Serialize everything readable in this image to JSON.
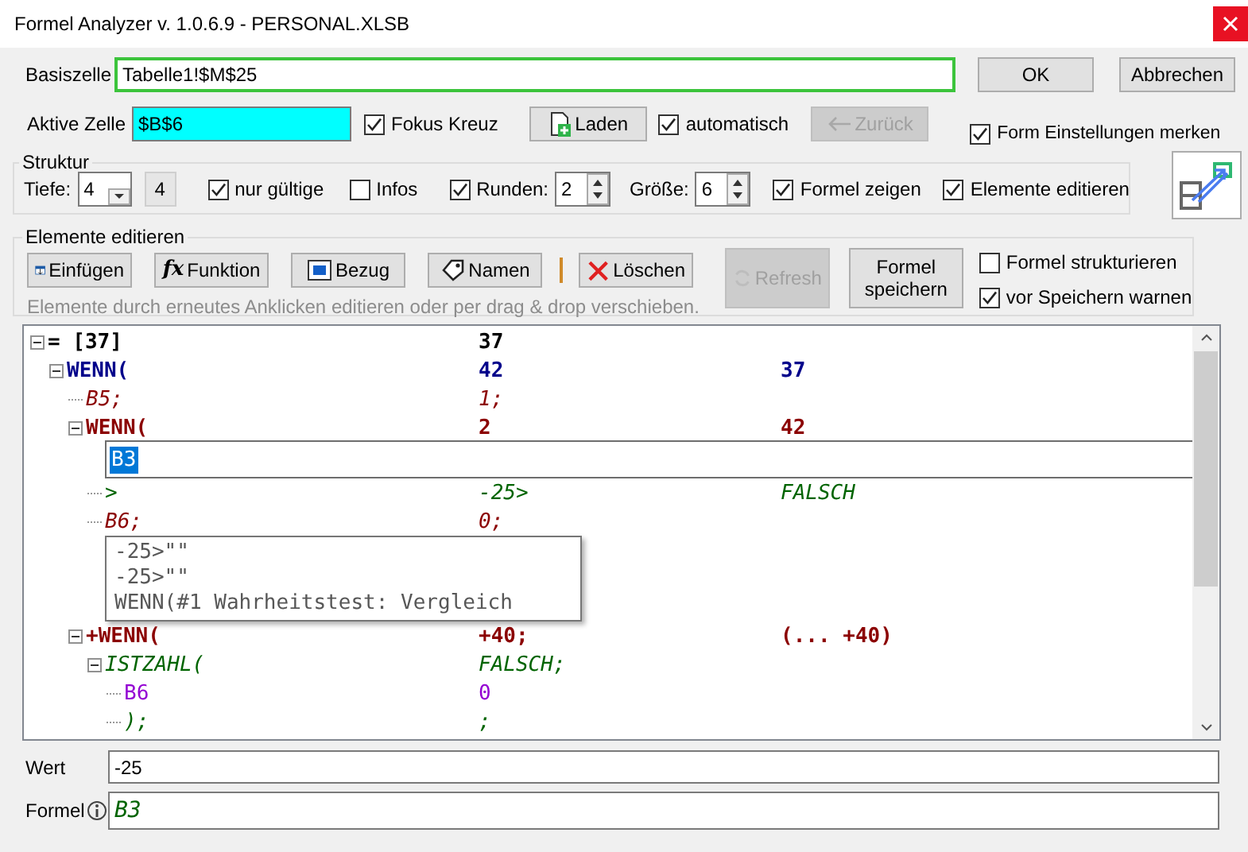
{
  "window": {
    "title": "Formel Analyzer v. 1.0.6.9 - PERSONAL.XLSB"
  },
  "base_cell": {
    "label": "Basiszelle",
    "value": "Tabelle1!$M$25"
  },
  "dialog_buttons": [
    {
      "label": "OK"
    },
    {
      "label": "Abbrechen"
    }
  ],
  "active_cell": {
    "label": "Aktive Zelle",
    "value": "$B$6"
  },
  "top_controls": [
    {
      "kind": "checkbox",
      "label": "Fokus Kreuz",
      "checked": true
    },
    {
      "kind": "button",
      "label": "Laden",
      "disabled": false
    },
    {
      "kind": "checkbox",
      "label": "automatisch",
      "checked": true
    },
    {
      "kind": "button",
      "label": "Zurück",
      "disabled": true
    }
  ],
  "remember_settings": {
    "label": "Form Einstellungen merken",
    "checked": true
  },
  "structure": {
    "title": "Struktur",
    "items": [
      {
        "kind": "dropdown",
        "label": "Tiefe:",
        "value": "4"
      },
      {
        "kind": "display",
        "value": "4"
      },
      {
        "kind": "checkbox",
        "label": "nur gültige",
        "checked": true
      },
      {
        "kind": "checkbox",
        "label": "Infos",
        "checked": false
      },
      {
        "kind": "checkbox",
        "label": "Runden:",
        "checked": true
      },
      {
        "kind": "spinner",
        "value": "2"
      },
      {
        "kind": "spinner",
        "label": "Größe:",
        "value": "6"
      },
      {
        "kind": "checkbox",
        "label": "Formel zeigen",
        "checked": true
      },
      {
        "kind": "checkbox",
        "label": "Elemente editieren",
        "checked": true
      }
    ]
  },
  "edit": {
    "title": "Elemente editieren",
    "tools": [
      {
        "label": "Einfügen"
      },
      {
        "label": "Funktion",
        "icon_text": "fx"
      },
      {
        "label": "Bezug"
      },
      {
        "label": "Namen"
      },
      {
        "label": "Löschen"
      }
    ],
    "refresh": {
      "label": "Refresh",
      "disabled": true
    },
    "save": {
      "label": "Formel speichern"
    },
    "options": [
      {
        "label": "Formel strukturieren",
        "checked": false
      },
      {
        "label": "vor Speichern warnen",
        "checked": true
      }
    ],
    "hint": "Elemente durch erneutes Anklicken editieren oder per drag & drop verschieben."
  },
  "tree": {
    "rows": [
      {
        "kind": "root",
        "text": "= [37]",
        "value": "37",
        "color": "#000000",
        "expanded": true,
        "children": [
          {
            "kind": "function",
            "text": "WENN(",
            "value": "42",
            "value2": "37",
            "color": "#00008b",
            "expanded": true,
            "children": [
              {
                "kind": "reference",
                "text": "B5;",
                "value": "1;",
                "color": "#8b0000"
              },
              {
                "kind": "function",
                "text": "WENN(",
                "value": "2",
                "value2": "42",
                "color": "#8b0000",
                "expanded": true,
                "children": [
                  {
                    "kind": "editor",
                    "value": "B3"
                  },
                  {
                    "kind": "operator",
                    "text": ">",
                    "value": "-25>",
                    "value2": "FALSCH",
                    "color": "#006400"
                  },
                  {
                    "kind": "reference",
                    "text": "B6;",
                    "value": "0;",
                    "color": "#8b0000"
                  },
                  {
                    "kind": "tooltip",
                    "lines": [
                      "-25>\"\"",
                      "-25>\"\"",
                      "WENN(#1 Wahrheitstest: Vergleich"
                    ]
                  }
                ]
              },
              {
                "kind": "function",
                "text": "+WENN(",
                "value": "+40;",
                "value2": "(... +40)",
                "color": "#8b0000",
                "expanded": true,
                "children": [
                  {
                    "kind": "test",
                    "text": "ISTZAHL(",
                    "value": "FALSCH;",
                    "color": "#006400",
                    "expanded": true,
                    "children": [
                      {
                        "kind": "cell",
                        "text": "B6",
                        "value": "0",
                        "color": "#9400d3"
                      },
                      {
                        "kind": "test",
                        "text": ");",
                        "value": ";",
                        "color": "#006400"
                      }
                    ]
                  }
                ]
              }
            ]
          }
        ]
      }
    ]
  },
  "value_field": {
    "label": "Wert",
    "value": "-25"
  },
  "formula_field": {
    "label": "Formel",
    "value": "B3"
  }
}
